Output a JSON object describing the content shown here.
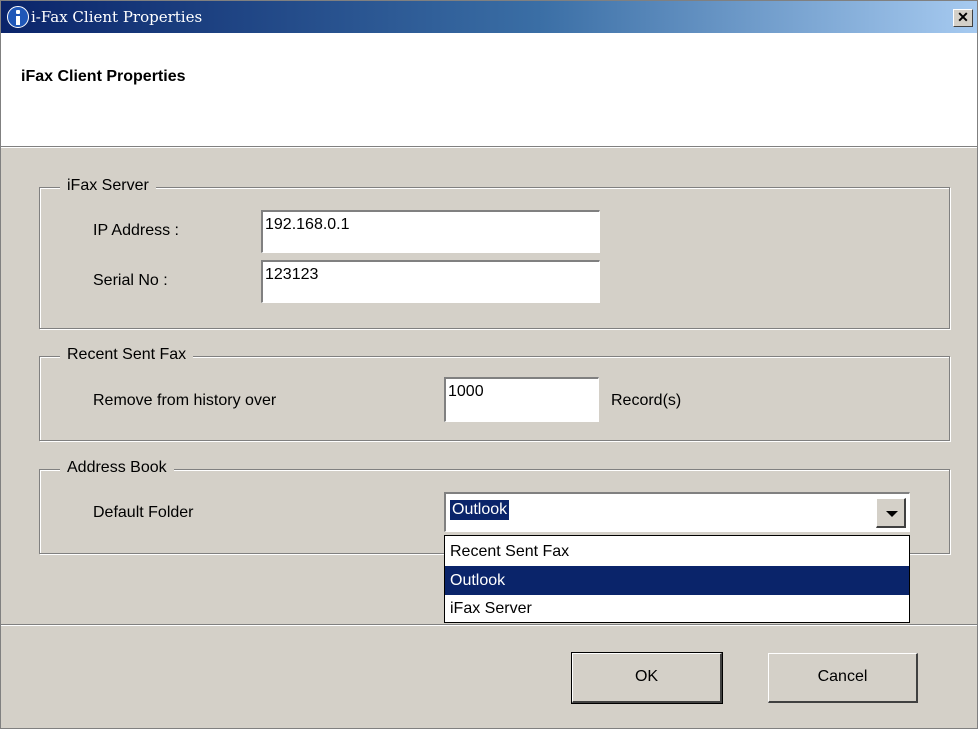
{
  "window": {
    "title": "i-Fax Client Properties",
    "close_glyph": "✕"
  },
  "header": {
    "title": "iFax Client Properties"
  },
  "server_group": {
    "legend": "iFax Server",
    "ip_label": "IP Address :",
    "ip_value": "192.168.0.1",
    "serial_label": "Serial No :",
    "serial_value": "123123"
  },
  "recent_group": {
    "legend": "Recent Sent Fax",
    "remove_label": "Remove from history over",
    "remove_value": "1000",
    "unit_label": "Record(s)"
  },
  "addressbook_group": {
    "legend": "Address Book",
    "folder_label": "Default Folder",
    "folder_selected": "Outlook",
    "options": [
      "Recent Sent Fax",
      "Outlook",
      "iFax Server"
    ]
  },
  "buttons": {
    "ok": "OK",
    "cancel": "Cancel"
  },
  "colors": {
    "face": "#d4d0c8",
    "title_start": "#0a246a",
    "title_end": "#a6caf0",
    "selection": "#0a246a"
  },
  "icons": [
    "info-icon",
    "close-icon",
    "chevron-down-icon"
  ]
}
